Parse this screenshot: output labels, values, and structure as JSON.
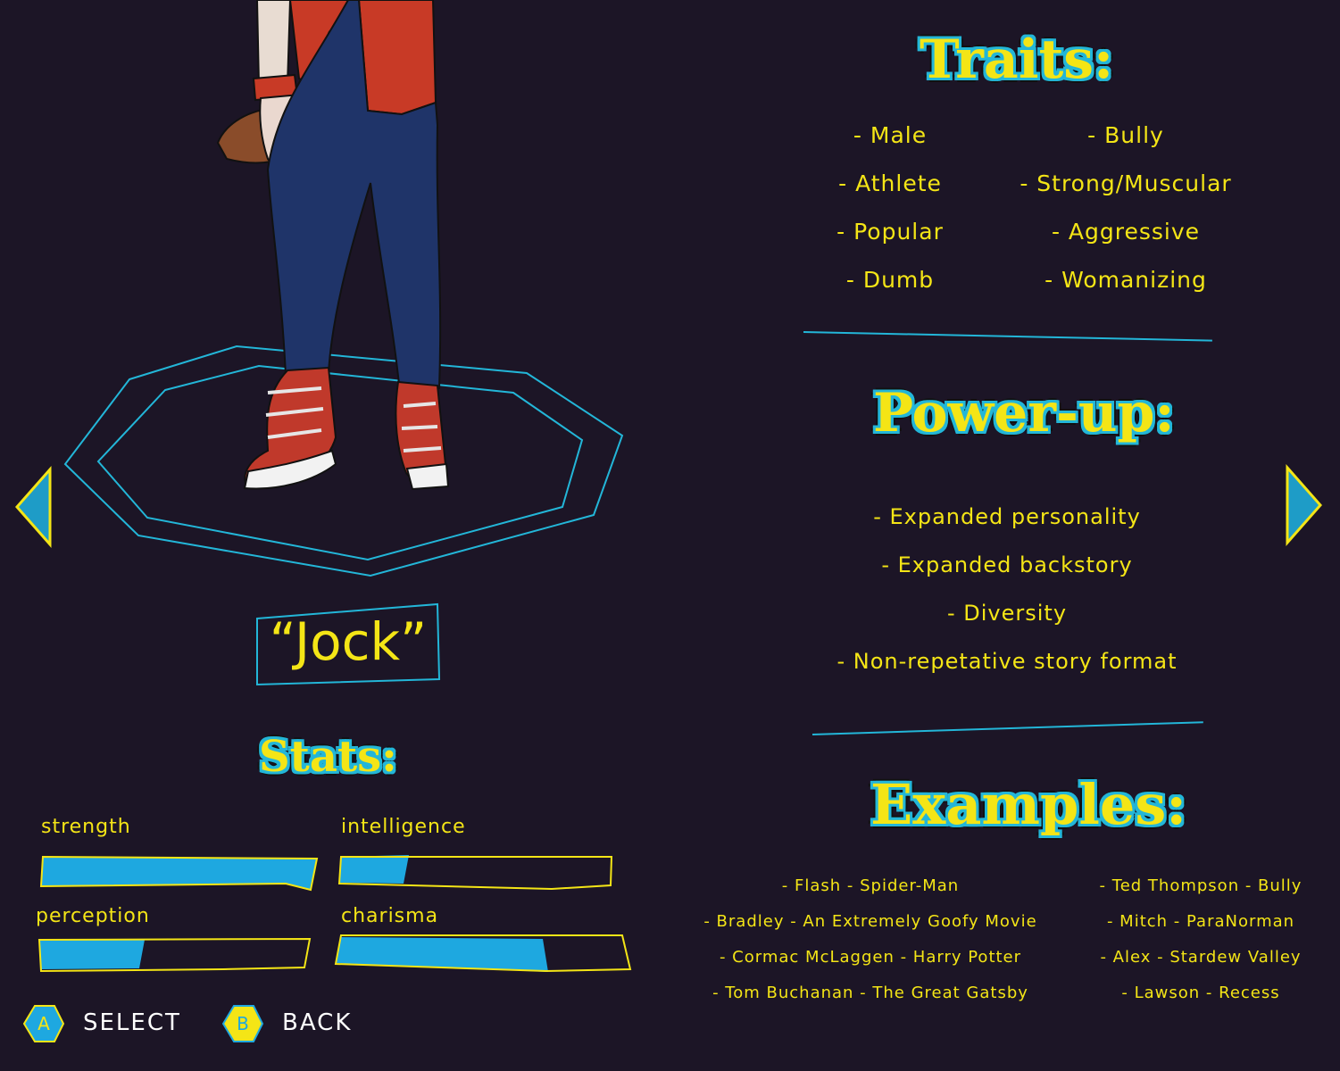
{
  "character": {
    "name": "“Jock”"
  },
  "headings": {
    "traits": "Traits:",
    "powerup": "Power-up:",
    "examples": "Examples:",
    "stats": "Stats:"
  },
  "traits": {
    "left": [
      "- Male",
      "- Athlete",
      "- Popular",
      "- Dumb"
    ],
    "right": [
      "- Bully",
      "- Strong/Muscular",
      "- Aggressive",
      "- Womanizing"
    ]
  },
  "powerups": [
    "- Expanded personality",
    "- Expanded backstory",
    "- Diversity",
    "- Non-repetative story format"
  ],
  "examples": {
    "left": [
      "- Flash - Spider-Man",
      "- Bradley - An Extremely Goofy Movie",
      "- Cormac McLaggen - Harry Potter",
      "- Tom Buchanan - The Great Gatsby"
    ],
    "right": [
      "- Ted Thompson - Bully",
      "- Mitch - ParaNorman",
      "- Alex - Stardew Valley",
      "- Lawson - Recess"
    ]
  },
  "stats": [
    {
      "label": "strength",
      "level": 1.0
    },
    {
      "label": "intelligence",
      "level": 0.25
    },
    {
      "label": "perception",
      "level": 0.38
    },
    {
      "label": "charisma",
      "level": 0.72
    }
  ],
  "buttons": {
    "select": {
      "key": "A",
      "label": "SELECT"
    },
    "back": {
      "key": "B",
      "label": "BACK"
    }
  },
  "colors": {
    "background": "#1c1526",
    "accent_yellow": "#f4e516",
    "accent_cyan": "#23b6d8",
    "bar_fill": "#1ea8e0"
  }
}
